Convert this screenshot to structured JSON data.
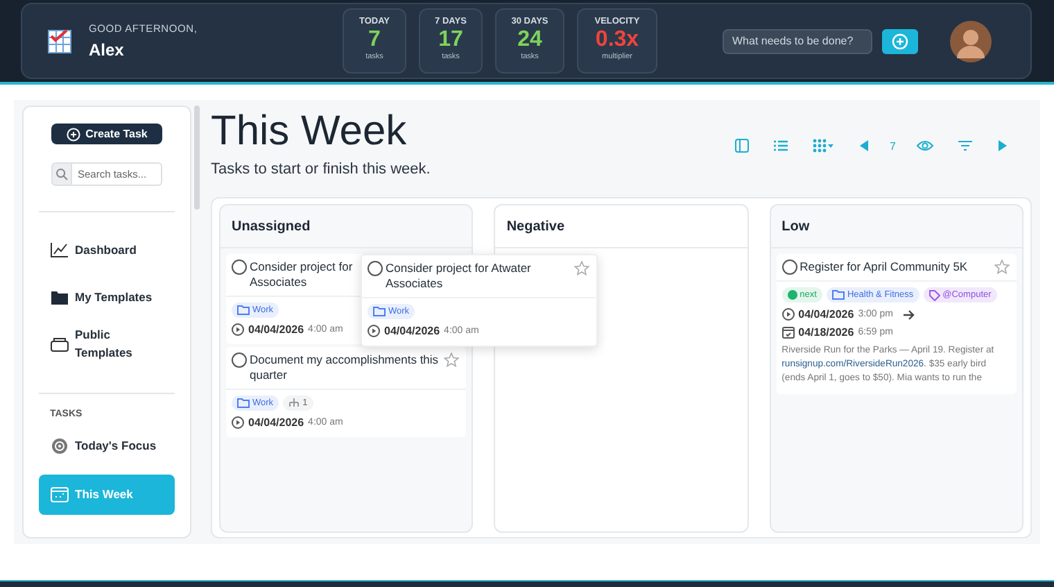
{
  "header": {
    "greeting": "GOOD AFTERNOON,",
    "name": "Alex",
    "stats": [
      {
        "label": "TODAY",
        "value": "7",
        "unit": "tasks",
        "color": "#7ed35b"
      },
      {
        "label": "7 DAYS",
        "value": "17",
        "unit": "tasks",
        "color": "#7ed35b"
      },
      {
        "label": "30 DAYS",
        "value": "24",
        "unit": "tasks",
        "color": "#7ed35b"
      },
      {
        "label": "VELOCITY",
        "value": "0.3x",
        "unit": "multiplier",
        "color": "#f0443c"
      }
    ],
    "quick_add": {
      "placeholder": "What needs to be done?"
    }
  },
  "sidebar": {
    "create_button": "Create Task",
    "search": {
      "placeholder": "Search tasks..."
    },
    "items": [
      {
        "label": "Dashboard",
        "selected": false
      },
      {
        "label": "My Templates",
        "selected": false
      },
      {
        "label": "Public Templates",
        "selected": false
      }
    ],
    "section": "TASKS",
    "task_items": [
      {
        "label": "Today's Focus",
        "selected": false
      },
      {
        "label": "This Week",
        "selected": true
      }
    ]
  },
  "page": {
    "title": "This Week",
    "subtitle": "Tasks to start or finish this week.",
    "toolbar_count": "7"
  },
  "columns": [
    {
      "title": "Unassigned",
      "cards": [
        {
          "title_lines": [
            "Consider project for",
            "Associates"
          ],
          "partial": true,
          "tags": [
            {
              "kind": "folder",
              "text": "Work"
            }
          ],
          "start": {
            "date": "04/04/2026",
            "time": "4:00 am"
          }
        },
        {
          "title_lines": [
            "Document my accomplishments this",
            "quarter"
          ],
          "starred": false,
          "tags": [
            {
              "kind": "folder",
              "text": "Work"
            },
            {
              "kind": "subtasks",
              "text": "1"
            }
          ],
          "start": {
            "date": "04/04/2026",
            "time": "4:00 am"
          }
        }
      ]
    },
    {
      "title": "Negative"
    },
    {
      "title": "Low",
      "cards": [
        {
          "title_lines": [
            "Register for April Community 5K"
          ],
          "starred": false,
          "tags": [
            {
              "kind": "status",
              "text": "next"
            },
            {
              "kind": "folder",
              "text": "Health & Fitness"
            },
            {
              "kind": "context",
              "text": "@Computer"
            }
          ],
          "start": {
            "date": "04/04/2026",
            "time": "3:00 pm",
            "arrow": true
          },
          "due": {
            "date": "04/18/2026",
            "time": "6:59 pm"
          },
          "note": {
            "before": "Riverside Run for the Parks — April 19. Register at ",
            "link": "runsignup.com/RiversideRun2026",
            "after": ". $35 early bird (ends April 1, goes to $50). Mia wants to run the"
          }
        }
      ]
    }
  ],
  "drag_card": {
    "title_lines": [
      "Consider project for Atwater",
      "Associates"
    ],
    "starred": false,
    "tags": [
      {
        "kind": "folder",
        "text": "Work"
      }
    ],
    "start": {
      "date": "04/04/2026",
      "time": "4:00 am"
    }
  }
}
